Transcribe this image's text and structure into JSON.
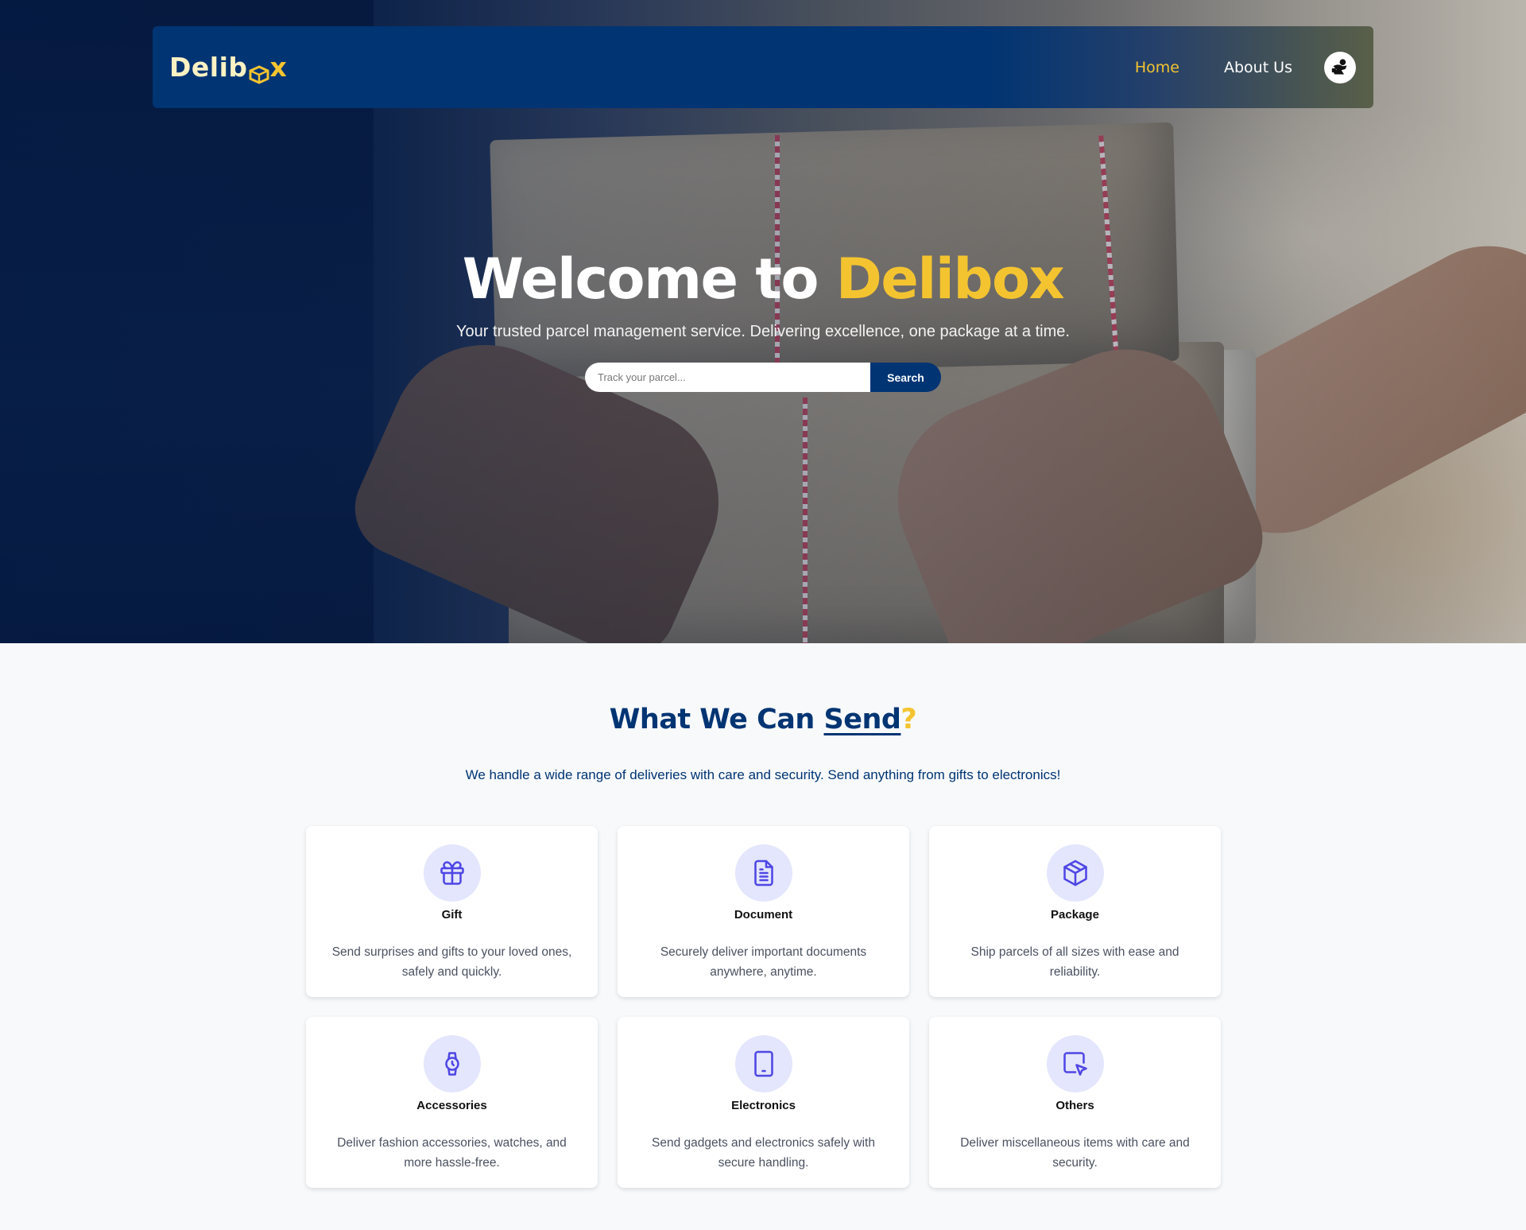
{
  "colors": {
    "primary": "#003473",
    "accent": "#f4c430",
    "icon": "#4f46e5",
    "icon_bg": "#e3e6fc",
    "page_bg": "#f7f9fb"
  },
  "navbar": {
    "logo_prefix": "Delib",
    "logo_suffix": "x",
    "links": [
      {
        "label": "Home",
        "active": true
      },
      {
        "label": "About Us",
        "active": false
      }
    ],
    "avatar_icon": "user-avatar-icon"
  },
  "hero": {
    "title_prefix": "Welcome to ",
    "title_brand": "Delibox",
    "subtitle": "Your trusted parcel management service. Delivering excellence, one package at a time.",
    "search": {
      "placeholder": "Track your parcel...",
      "value": "",
      "button_label": "Search"
    }
  },
  "services": {
    "title_prefix": "What We Can ",
    "title_underlined": "Send",
    "title_suffix": "?",
    "description": "We handle a wide range of deliveries with care and security. Send anything from gifts to electronics!",
    "items": [
      {
        "icon": "gift-icon",
        "title": "Gift",
        "description": "Send surprises and gifts to your loved ones, safely and quickly."
      },
      {
        "icon": "document-icon",
        "title": "Document",
        "description": "Securely deliver important documents anywhere, anytime."
      },
      {
        "icon": "package-icon",
        "title": "Package",
        "description": "Ship parcels of all sizes with ease and reliability."
      },
      {
        "icon": "watch-icon",
        "title": "Accessories",
        "description": "Deliver fashion accessories, watches, and more hassle-free."
      },
      {
        "icon": "tablet-icon",
        "title": "Electronics",
        "description": "Send gadgets and electronics safely with secure handling."
      },
      {
        "icon": "cursor-icon",
        "title": "Others",
        "description": "Deliver miscellaneous items with care and security."
      }
    ]
  }
}
